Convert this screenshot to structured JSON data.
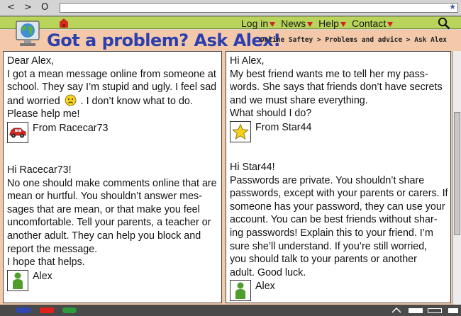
{
  "browser": {
    "back": "<",
    "forward": ">",
    "reload": "O",
    "star": "★"
  },
  "nav": {
    "items": [
      "Log in",
      "News",
      "Help",
      "Contact"
    ]
  },
  "header": {
    "title": "Got a problem? Ask Alex!",
    "breadcrumb": "Online Saftey > Problems and advice > Ask Alex"
  },
  "left_panel": {
    "question": {
      "lines": [
        "Dear Alex,",
        "I got a mean message online from someone at",
        "school. They say I’m stupid and ugly. I feel sad",
        "and worried",
        ". I don’t know what to do.",
        "Please help me!"
      ],
      "from": "From Racecar73",
      "icon": "red-car-icon"
    },
    "answer": {
      "lines": [
        "Hi Racecar73!",
        "No one should make comments online that are",
        "mean or hurtful. You shouldn’t answer mes-",
        "sages that are mean, or that make you feel",
        "uncomfortable. Tell your parents, a teacher or",
        "another adult. They can help you block and",
        "report the message.",
        "I hope that helps."
      ],
      "from": "Alex",
      "icon": "person-icon"
    }
  },
  "right_panel": {
    "question": {
      "lines": [
        "Hi Alex,",
        "My best friend wants me to tell her my pass-",
        "words. She says that friends don’t have secrets",
        "and we must share everything.",
        "What should I do?"
      ],
      "from": "From Star44",
      "icon": "yellow-star-icon"
    },
    "answer": {
      "lines": [
        "Hi Star44!",
        "Passwords are private. You shouldn’t share",
        "passwords, except with your parents or carers. If",
        "someone has your password, they can use your",
        "account. You can be best friends without shar-",
        "ing passwords! Explain this to your friend. I’m",
        "sure she’ll  understand. If you’re still worried,",
        "you should talk to your parents or another",
        "adult. Good luck."
      ],
      "from": "Alex",
      "icon": "person-icon"
    }
  },
  "colors": {
    "nav_green": "#b9d45a",
    "peach": "#f3c9a9",
    "title_blue": "#2c3fae",
    "caret_red": "#d02020"
  }
}
